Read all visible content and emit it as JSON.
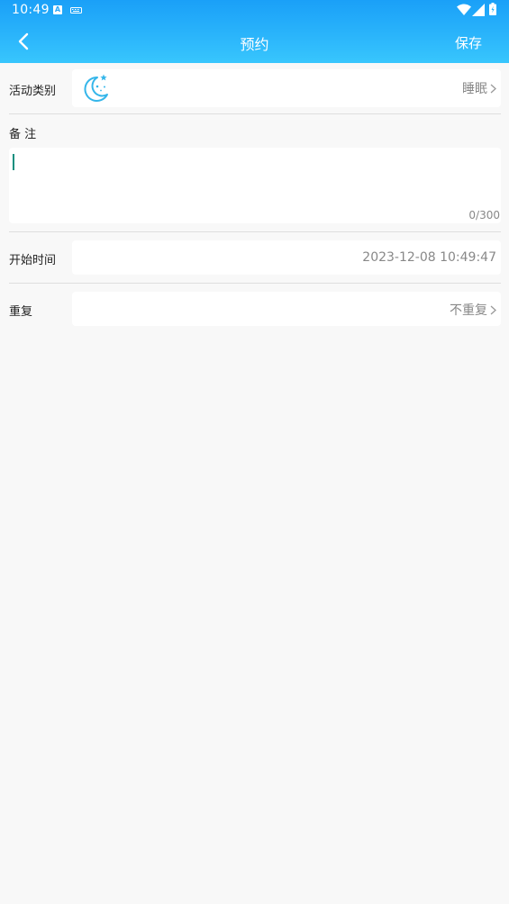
{
  "status_bar": {
    "time": "10:49",
    "icons": [
      "app-a-icon",
      "keyboard-icon",
      "wifi-icon",
      "signal-icon",
      "battery-icon"
    ]
  },
  "header": {
    "title": "预约",
    "save_label": "保存",
    "back_icon": "chevron-left-icon",
    "colors": {
      "gradient_top": "#1aa0f8",
      "gradient_bottom": "#38c6fd",
      "text": "#ffffff"
    }
  },
  "form": {
    "activity_type": {
      "label": "活动类别",
      "icon": "moon-star-icon",
      "value": "睡眠"
    },
    "notes": {
      "label": "备 注",
      "value": "",
      "counter": "0/300"
    },
    "start_time": {
      "label": "开始时间",
      "value": "2023-12-08 10:49:47"
    },
    "repeat": {
      "label": "重复",
      "value": "不重复"
    }
  },
  "colors": {
    "page_background": "#f8f8f8",
    "value_text": "#888888",
    "icon_accent": "#35b6ea",
    "caret": "#0d8f7e"
  }
}
